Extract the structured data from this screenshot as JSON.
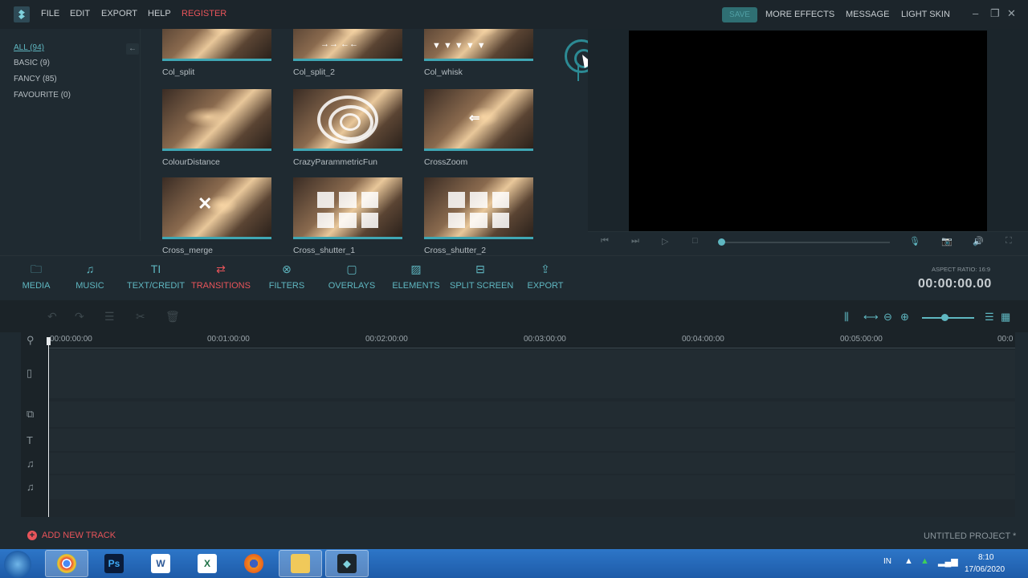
{
  "menu": {
    "items": [
      "FILE",
      "EDIT",
      "EXPORT",
      "HELP",
      "REGISTER"
    ],
    "right": [
      "SAVE",
      "MORE EFFECTS",
      "MESSAGE",
      "LIGHT SKIN"
    ]
  },
  "categories": [
    {
      "label": "ALL (94)",
      "active": true
    },
    {
      "label": "BASIC (9)"
    },
    {
      "label": "FANCY (85)"
    },
    {
      "label": "FAVOURITE (0)"
    }
  ],
  "transitions": [
    {
      "label": "Col_split",
      "icon": "col-split"
    },
    {
      "label": "Col_split_2",
      "icon": "arrows-in"
    },
    {
      "label": "Col_whisk",
      "icon": "arrows-down"
    },
    {
      "label": "ColourDistance",
      "icon": "sparkle"
    },
    {
      "label": "CrazyParammetricFun",
      "icon": "rings"
    },
    {
      "label": "CrossZoom",
      "icon": "arrow-left"
    },
    {
      "label": "Cross_merge",
      "icon": "arrows-converge"
    },
    {
      "label": "Cross_shutter_1",
      "icon": "boxes"
    },
    {
      "label": "Cross_shutter_2",
      "icon": "boxes"
    }
  ],
  "toolbar": {
    "tabs": [
      {
        "label": "MEDIA",
        "icon": "folder-icon"
      },
      {
        "label": "MUSIC",
        "icon": "music-icon"
      },
      {
        "label": "TEXT/CREDIT",
        "icon": "text-icon"
      },
      {
        "label": "TRANSITIONS",
        "icon": "transition-icon",
        "active": true
      },
      {
        "label": "FILTERS",
        "icon": "filter-icon"
      },
      {
        "label": "OVERLAYS",
        "icon": "overlay-icon"
      },
      {
        "label": "ELEMENTS",
        "icon": "image-icon"
      },
      {
        "label": "SPLIT SCREEN",
        "icon": "split-icon"
      },
      {
        "label": "EXPORT",
        "icon": "share-icon"
      }
    ],
    "aspect_ratio": "ASPECT RATIO: 16:9",
    "timecode": "00:00:00.00"
  },
  "timeline": {
    "ticks": [
      "00:00:00:00",
      "00:01:00:00",
      "00:02:00:00",
      "00:03:00:00",
      "00:04:00:00",
      "00:05:00:00",
      "00:0"
    ]
  },
  "footer": {
    "add_track": "ADD NEW TRACK",
    "project": "UNTITLED PROJECT *"
  },
  "taskbar": {
    "lang": "IN",
    "time": "8:10",
    "date": "17/06/2020"
  },
  "colors": {
    "accent": "#5fb7c1",
    "active": "#e8545a",
    "background": "#1f2a31"
  }
}
